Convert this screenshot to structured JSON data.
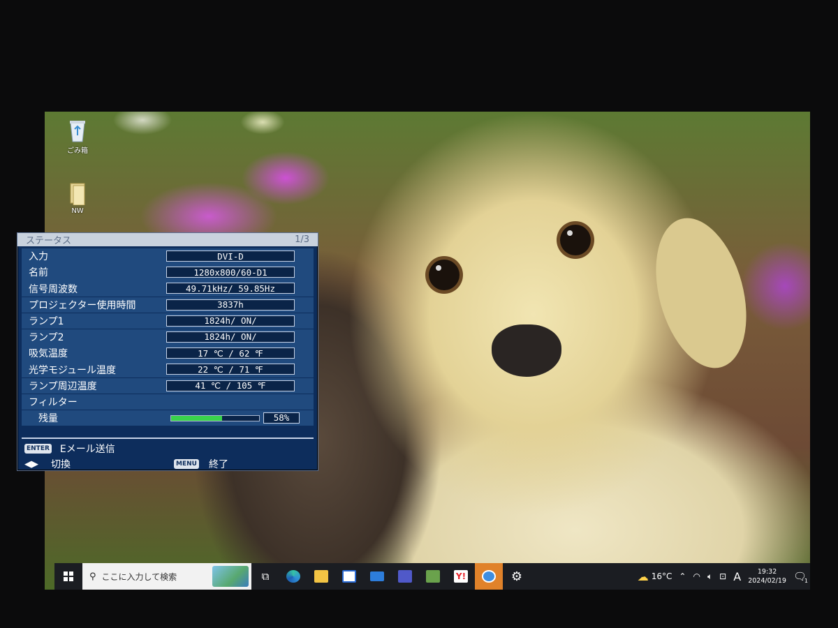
{
  "desktop": {
    "icons": [
      {
        "label": "ごみ箱",
        "icon": "recycle-bin-icon"
      },
      {
        "label": "NW",
        "icon": "folder-icon"
      }
    ]
  },
  "osd": {
    "title": "ステータス",
    "page": "1/3",
    "rows": [
      {
        "label": "入力",
        "value": "DVI-D"
      },
      {
        "label": "名前",
        "value": "1280x800/60-D1"
      },
      {
        "label": "信号周波数",
        "value": "49.71kHz/ 59.85Hz"
      },
      {
        "label": "プロジェクター使用時間",
        "value": "3837h"
      },
      {
        "label": "ランプ1",
        "value": "1824h/  ON/"
      },
      {
        "label": "ランプ2",
        "value": "1824h/  ON/"
      },
      {
        "label": "吸気温度",
        "value": "17 ℃ /  62 ℉"
      },
      {
        "label": "光学モジュール温度",
        "value": "22 ℃ /  71 ℉"
      },
      {
        "label": "ランプ周辺温度",
        "value": "41 ℃ / 105 ℉"
      }
    ],
    "filter_label": "フィルター",
    "remaining_label": "残量",
    "remaining_percent": 58,
    "remaining_text": "58%",
    "footer": {
      "enter_key": "ENTER",
      "enter_action": "Eメール送信",
      "arrows_action": "切換",
      "menu_key": "MENU",
      "menu_action": "終了"
    },
    "colors": {
      "panel": "#0d2d5c",
      "row": "#204a7e",
      "bar": "#39d34b"
    }
  },
  "taskbar": {
    "search_placeholder": "ここに入力して検索",
    "weather": "16°C",
    "ime": "A",
    "time": "19:32",
    "date": "2024/02/19",
    "notification_count": "1",
    "apps": [
      {
        "name": "task-view-icon"
      },
      {
        "name": "edge-icon",
        "color": "#2f8fd6"
      },
      {
        "name": "file-explorer-icon",
        "color": "#f3c444"
      },
      {
        "name": "store-icon",
        "color": "#2a6ad4"
      },
      {
        "name": "mail-icon",
        "color": "#2d7ddb"
      },
      {
        "name": "teams-icon",
        "color": "#5059c9"
      },
      {
        "name": "pc-app-icon",
        "color": "#6aa24c"
      },
      {
        "name": "yahoo-icon",
        "color": "#e8232b"
      },
      {
        "name": "browser-app-icon",
        "color": "#3f8ee0"
      },
      {
        "name": "settings-icon",
        "color": "#ffffff"
      }
    ]
  }
}
